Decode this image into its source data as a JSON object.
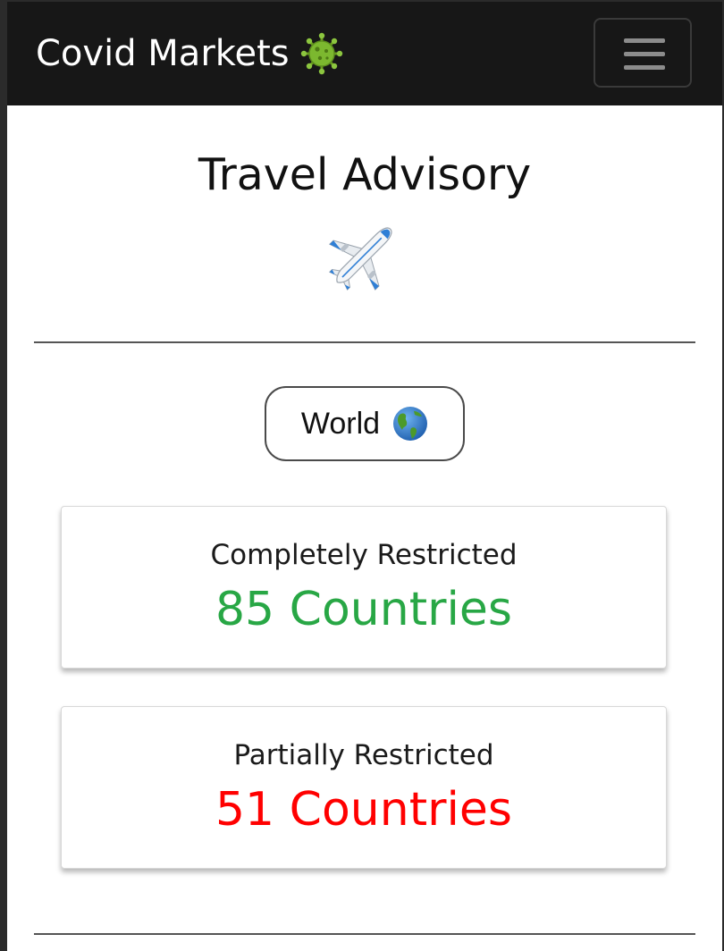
{
  "navbar": {
    "brand": "Covid Markets",
    "brand_icon": "virus-icon",
    "menu_icon": "hamburger-menu-icon"
  },
  "main": {
    "title": "Travel Advisory",
    "title_icon": "airplane-icon",
    "region_button": {
      "label": "World",
      "icon": "globe-icon"
    },
    "cards": [
      {
        "label": "Completely Restricted",
        "value": "85 Countries",
        "color": "#28a745"
      },
      {
        "label": "Partially Restricted",
        "value": "51 Countries",
        "color": "#ff0000"
      }
    ]
  },
  "colors": {
    "navbar_bg": "#171717",
    "success": "#28a745",
    "danger": "#ff0000"
  }
}
